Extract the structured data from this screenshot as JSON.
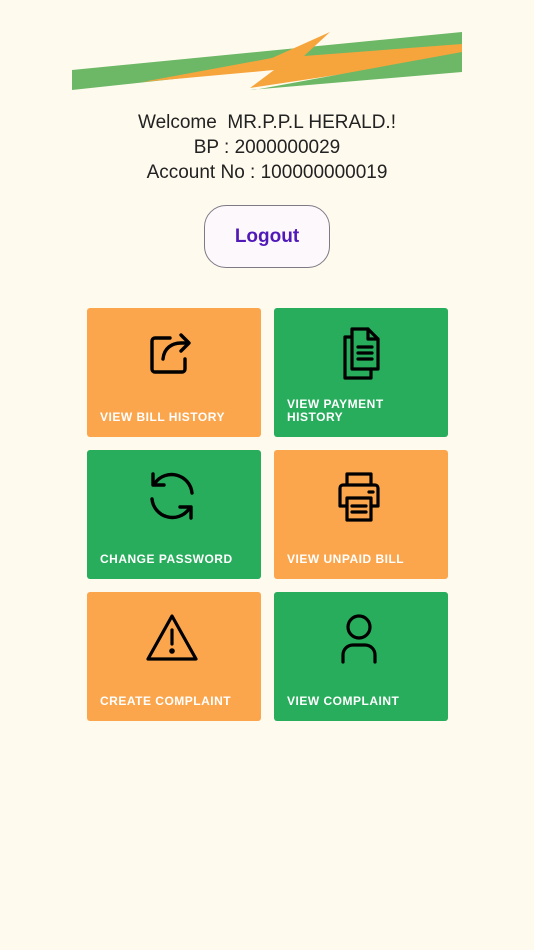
{
  "header": {
    "welcome_text": "Welcome  MR.P.P.L HERALD.!",
    "bp_text": "BP : 2000000029",
    "account_text": "Account No : 100000000019"
  },
  "logout_label": "Logout",
  "colors": {
    "background": "#fffaee",
    "orange": "#fba64c",
    "green": "#27ad5c",
    "logout_text": "#5119b8"
  },
  "tiles": [
    {
      "label": "VIEW BILL HISTORY",
      "icon": "share-square-icon"
    },
    {
      "label": "VIEW PAYMENT HISTORY",
      "icon": "document-icon"
    },
    {
      "label": "CHANGE PASSWORD",
      "icon": "refresh-icon"
    },
    {
      "label": "VIEW UNPAID BILL",
      "icon": "printer-icon"
    },
    {
      "label": "CREATE COMPLAINT",
      "icon": "warning-icon"
    },
    {
      "label": "VIEW COMPLAINT",
      "icon": "user-icon"
    }
  ]
}
